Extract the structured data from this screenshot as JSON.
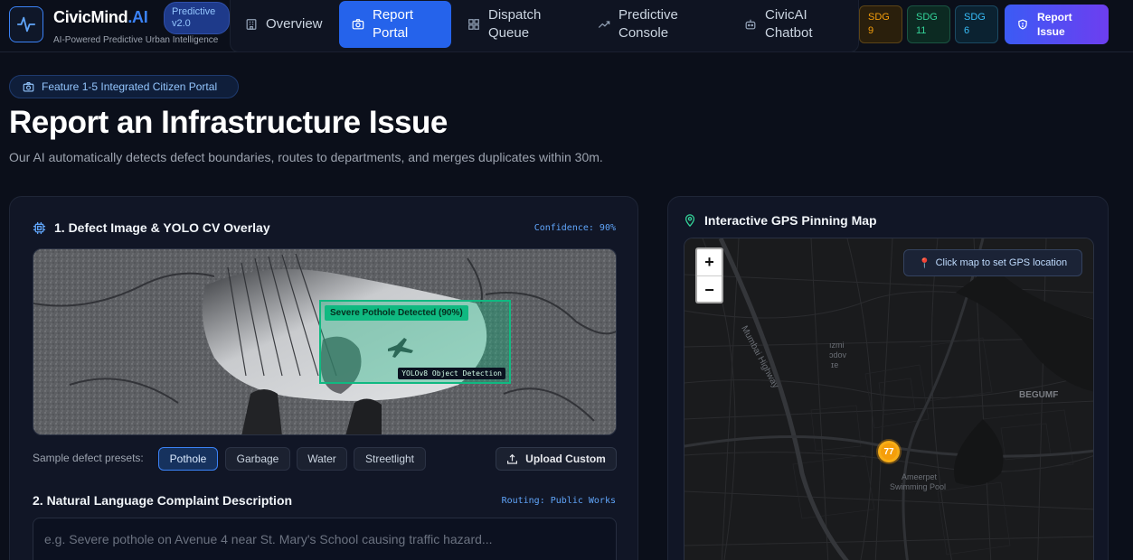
{
  "brand": {
    "name": "CivicMind",
    "name_suffix": ".AI",
    "tagline": "AI-Powered Predictive Urban Intelligence",
    "version": "Predictive v2.0"
  },
  "nav": {
    "items": [
      {
        "label": "Overview",
        "icon": "building-icon"
      },
      {
        "label": "Report Portal",
        "icon": "camera-icon",
        "active": true
      },
      {
        "label": "Dispatch Queue",
        "icon": "grid-icon"
      },
      {
        "label": "Predictive Console",
        "icon": "trend-icon"
      },
      {
        "label": "CivicAI Chatbot",
        "icon": "bot-icon"
      }
    ]
  },
  "sdg_badges": [
    {
      "label": "SDG",
      "num": "9",
      "color": "#f59e0b"
    },
    {
      "label": "SDG",
      "num": "11",
      "color": "#34d399"
    },
    {
      "label": "SDG",
      "num": "6",
      "color": "#38bdf8"
    }
  ],
  "header_cta": {
    "label": "Report Issue"
  },
  "hero": {
    "pill": "Feature 1-5 Integrated Citizen Portal",
    "title": "Report an Infrastructure Issue",
    "subtitle": "Our AI automatically detects defect boundaries, routes to departments, and merges duplicates within 30m."
  },
  "defect_section": {
    "title": "1. Defect Image & YOLO CV Overlay",
    "confidence": "Confidence: 90%",
    "detection_label": "Severe Pothole Detected (90%)",
    "detector_label": "YOLOv8 Object Detection",
    "presets_label": "Sample defect presets:",
    "presets": [
      "Pothole",
      "Garbage",
      "Water",
      "Streetlight"
    ],
    "active_preset": "Pothole",
    "upload_label": "Upload Custom"
  },
  "complaint_section": {
    "title": "2. Natural Language Complaint Description",
    "routing": "Routing: Public Works",
    "placeholder": "e.g. Severe pothole on Avenue 4 near St. Mary's School causing traffic hazard..."
  },
  "map_section": {
    "title": "Interactive GPS Pinning Map",
    "hint": "Click map to set GPS location",
    "zoom_in": "+",
    "zoom_out": "−",
    "cluster_count": "77",
    "labels": {
      "road": "Mumbai Highway",
      "area1": "BEGUMF",
      "area2_line1": "Ameerpet",
      "area2_line2": "Swimming Pool",
      "area3_line1": "ızmi",
      "area3_line2": "ɔdov",
      "area3_line3": "ɪe"
    }
  },
  "colors": {
    "accent": "#2563eb",
    "detection": "#10b981",
    "cluster": "#f59e0b"
  }
}
